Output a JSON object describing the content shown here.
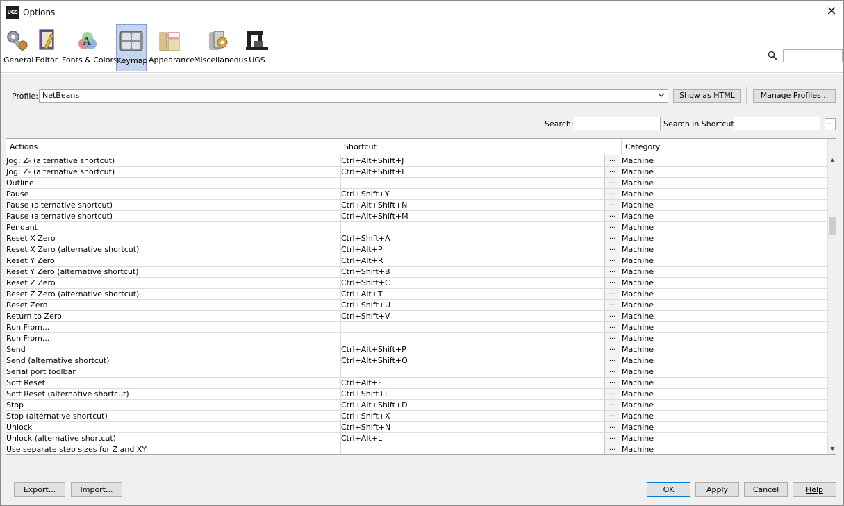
{
  "window": {
    "title": "Options",
    "app_icon_text": "UGS"
  },
  "categories": [
    {
      "label": "General",
      "icon": "wrench-gear-icon"
    },
    {
      "label": "Editor",
      "icon": "notebook-pencil-icon"
    },
    {
      "label": "Fonts & Colors",
      "icon": "font-palette-icon"
    },
    {
      "label": "Keymap",
      "icon": "keyboard-icon",
      "selected": true
    },
    {
      "label": "Appearance",
      "icon": "layout-icon"
    },
    {
      "label": "Miscellaneous",
      "icon": "misc-tools-icon"
    },
    {
      "label": "UGS",
      "icon": "ugs-machine-icon"
    }
  ],
  "profile": {
    "label": "Profile:",
    "value": "NetBeans",
    "show_html_label": "Show as HTML",
    "manage_label": "Manage Profiles..."
  },
  "search": {
    "search_label": "Search:",
    "search_value": "",
    "shortcut_label": "Search in Shortcuts:",
    "shortcut_value": "",
    "more_label": "..."
  },
  "table": {
    "columns": [
      "Actions",
      "Shortcut",
      "Category"
    ],
    "edit_label": "...",
    "rows": [
      {
        "action": "Jog: Z- (alternative shortcut)",
        "shortcut": "Ctrl+Alt+Shift+J",
        "category": "Machine"
      },
      {
        "action": "Jog: Z- (alternative shortcut)",
        "shortcut": "Ctrl+Alt+Shift+I",
        "category": "Machine"
      },
      {
        "action": "Outline",
        "shortcut": "",
        "category": "Machine"
      },
      {
        "action": "Pause",
        "shortcut": "Ctrl+Shift+Y",
        "category": "Machine"
      },
      {
        "action": "Pause (alternative shortcut)",
        "shortcut": "Ctrl+Alt+Shift+N",
        "category": "Machine"
      },
      {
        "action": "Pause (alternative shortcut)",
        "shortcut": "Ctrl+Alt+Shift+M",
        "category": "Machine"
      },
      {
        "action": "Pendant",
        "shortcut": "",
        "category": "Machine"
      },
      {
        "action": "Reset X Zero",
        "shortcut": "Ctrl+Shift+A",
        "category": "Machine"
      },
      {
        "action": "Reset X Zero (alternative shortcut)",
        "shortcut": "Ctrl+Alt+P",
        "category": "Machine"
      },
      {
        "action": "Reset Y Zero",
        "shortcut": "Ctrl+Alt+R",
        "category": "Machine"
      },
      {
        "action": "Reset Y Zero (alternative shortcut)",
        "shortcut": "Ctrl+Shift+B",
        "category": "Machine"
      },
      {
        "action": "Reset Z Zero",
        "shortcut": "Ctrl+Shift+C",
        "category": "Machine"
      },
      {
        "action": "Reset Z Zero (alternative shortcut)",
        "shortcut": "Ctrl+Alt+T",
        "category": "Machine"
      },
      {
        "action": "Reset Zero",
        "shortcut": "Ctrl+Shift+U",
        "category": "Machine"
      },
      {
        "action": "Return to Zero",
        "shortcut": "Ctrl+Shift+V",
        "category": "Machine"
      },
      {
        "action": "Run From...",
        "shortcut": "",
        "category": "Machine"
      },
      {
        "action": "Run From...",
        "shortcut": "",
        "category": "Machine"
      },
      {
        "action": "Send",
        "shortcut": "Ctrl+Alt+Shift+P",
        "category": "Machine"
      },
      {
        "action": "Send (alternative shortcut)",
        "shortcut": "Ctrl+Alt+Shift+O",
        "category": "Machine"
      },
      {
        "action": "Serial port toolbar",
        "shortcut": "",
        "category": "Machine"
      },
      {
        "action": "Soft Reset",
        "shortcut": "Ctrl+Alt+F",
        "category": "Machine"
      },
      {
        "action": "Soft Reset (alternative shortcut)",
        "shortcut": "Ctrl+Shift+I",
        "category": "Machine"
      },
      {
        "action": "Stop",
        "shortcut": "Ctrl+Alt+Shift+D",
        "category": "Machine"
      },
      {
        "action": "Stop (alternative shortcut)",
        "shortcut": "Ctrl+Shift+X",
        "category": "Machine"
      },
      {
        "action": "Unlock",
        "shortcut": "Ctrl+Shift+N",
        "category": "Machine"
      },
      {
        "action": "Unlock (alternative shortcut)",
        "shortcut": "Ctrl+Alt+L",
        "category": "Machine"
      },
      {
        "action": "Use separate step sizes for Z and XY",
        "shortcut": "",
        "category": "Machine"
      }
    ]
  },
  "footer": {
    "export_label": "Export...",
    "import_label": "Import...",
    "ok_label": "OK",
    "apply_label": "Apply",
    "cancel_label": "Cancel",
    "help_label": "Help"
  },
  "colors": {
    "selected_category_bg": "#c6d4ee",
    "selected_category_border": "#7f9dd6",
    "panel_bg": "#f0f0f0"
  }
}
